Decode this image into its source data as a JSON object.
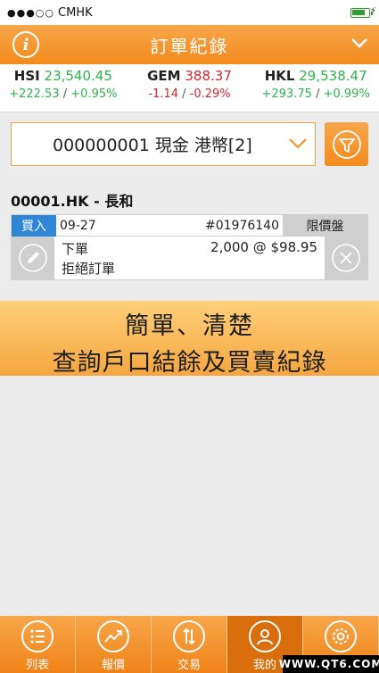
{
  "status_bar": {
    "signal": "●●●○○",
    "carrier": "CMHK"
  },
  "header": {
    "title": "訂單紀錄",
    "info_icon": "i"
  },
  "indices": [
    {
      "name": "HSI",
      "value": "23,540.45",
      "change": "+222.53",
      "pct": "+0.95%",
      "direction": "up"
    },
    {
      "name": "GEM",
      "value": "388.37",
      "change": "-1.14",
      "pct": "-0.29%",
      "direction": "down"
    },
    {
      "name": "HKL",
      "value": "29,538.47",
      "change": "+293.75",
      "pct": "+0.99%",
      "direction": "up"
    }
  ],
  "separator": "/",
  "account": {
    "selected": "000000001 現金 港幣[2]"
  },
  "order": {
    "stock": "00001.HK - 長和",
    "side": "買入",
    "date": "09-27",
    "order_no": "#01976140",
    "type": "限價盤",
    "action": "下單",
    "status": "拒絕訂單",
    "qty_price": "2,000 @ $98.95"
  },
  "promo": {
    "line1": "簡單、清楚",
    "line2": "查詢戶口結餘及買賣紀錄"
  },
  "tabs": [
    {
      "label": "列表",
      "icon": "list-icon",
      "active": false
    },
    {
      "label": "報價",
      "icon": "chart-trend-icon",
      "active": false
    },
    {
      "label": "交易",
      "icon": "trade-arrows-icon",
      "active": false
    },
    {
      "label": "我的",
      "icon": "user-icon",
      "active": true
    },
    {
      "label": "設定",
      "icon": "gear-icon",
      "active": false
    }
  ],
  "watermark": "WWW.QT6.COM",
  "colors": {
    "accent": "#f28b1d",
    "up": "#2fb24a",
    "down": "#d8262b",
    "buy": "#2f86d6"
  }
}
